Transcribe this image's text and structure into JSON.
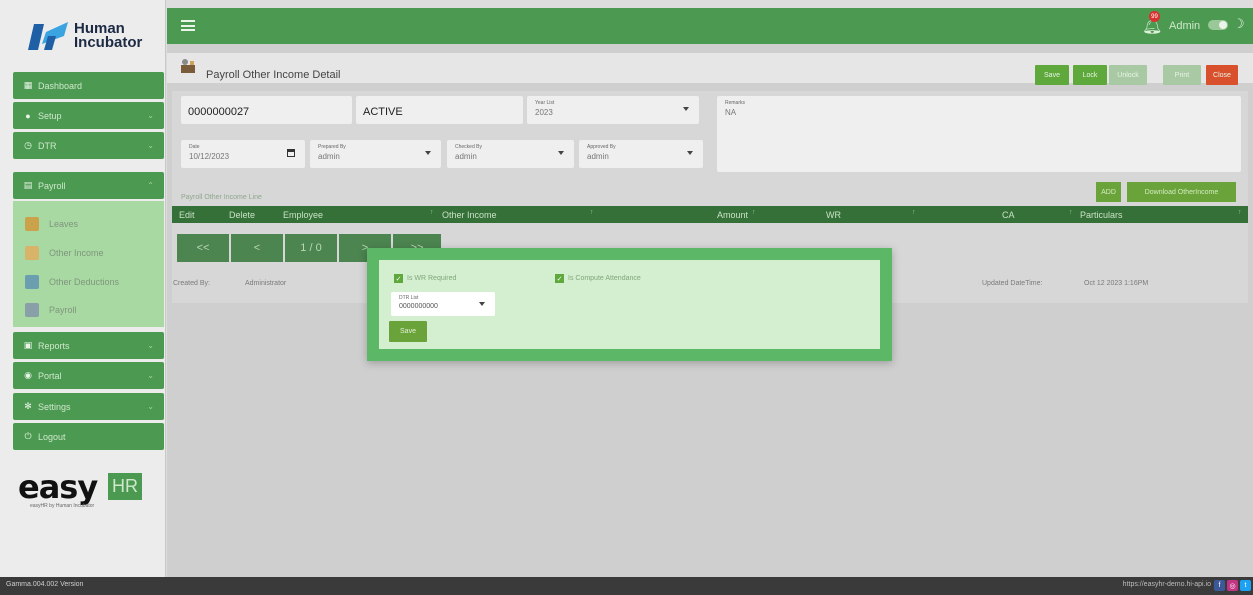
{
  "brand": {
    "line1": "Human",
    "line2": "Incubator"
  },
  "sidebar": {
    "items": [
      {
        "label": "Dashboard",
        "icon": "dashboard-icon"
      },
      {
        "label": "Setup",
        "icon": "gear-circle-icon"
      },
      {
        "label": "DTR",
        "icon": "clock-icon"
      },
      {
        "label": "Payroll",
        "icon": "payroll-icon"
      },
      {
        "label": "Reports",
        "icon": "printer-icon"
      },
      {
        "label": "Portal",
        "icon": "portal-icon"
      },
      {
        "label": "Settings",
        "icon": "gear-icon"
      },
      {
        "label": "Logout",
        "icon": "power-icon"
      }
    ],
    "subitems": [
      {
        "label": "Leaves"
      },
      {
        "label": "Other Income"
      },
      {
        "label": "Other Deductions"
      },
      {
        "label": "Payroll"
      }
    ],
    "footer_logo_text": "easy",
    "footer_logo_hr": "HR",
    "footer_tagline": "easyHR by Human Incubator"
  },
  "topbar": {
    "notification_count": "99",
    "user": "Admin"
  },
  "page": {
    "title": "Payroll Other Income Detail",
    "actions": {
      "save": "Save",
      "lock": "Lock",
      "unlock": "Unlock",
      "print": "Print",
      "close": "Close"
    }
  },
  "form": {
    "number": "0000000027",
    "status": "ACTIVE",
    "year_label": "Year List",
    "year_value": "2023",
    "remarks_label": "Remarks",
    "remarks_value": "NA",
    "date_label": "Date",
    "date_value": "10/12/2023",
    "prepared_label": "Prepared By",
    "prepared_value": "admin",
    "checked_label": "Checked By",
    "checked_value": "admin",
    "approved_label": "Approved By",
    "approved_value": "admin"
  },
  "lines": {
    "section_title": "Payroll Other Income Line",
    "add_label": "ADD",
    "download_label": "Download OtherIncome",
    "columns": [
      "Edit",
      "Delete",
      "Employee",
      "Other Income",
      "Amount",
      "WR",
      "CA",
      "Particulars"
    ],
    "pager": {
      "first": "<<",
      "prev": "<",
      "page": "1 / 0",
      "next": ">",
      "last": ">>"
    }
  },
  "footer_info": {
    "created_label": "Created By:",
    "created_value": "Administrator",
    "updated_label": "Updated DateTime:",
    "updated_value": "Oct 12 2023 1:16PM"
  },
  "modal": {
    "check1": "Is WR Required",
    "check2": "Is Compute Attendance",
    "field_label": "DTR List",
    "field_value": "0000000000",
    "save_label": "Save"
  },
  "status_bar": {
    "version": "Gamma.004.002 Version",
    "url": "https://easyhr-demo.hi-api.io"
  }
}
